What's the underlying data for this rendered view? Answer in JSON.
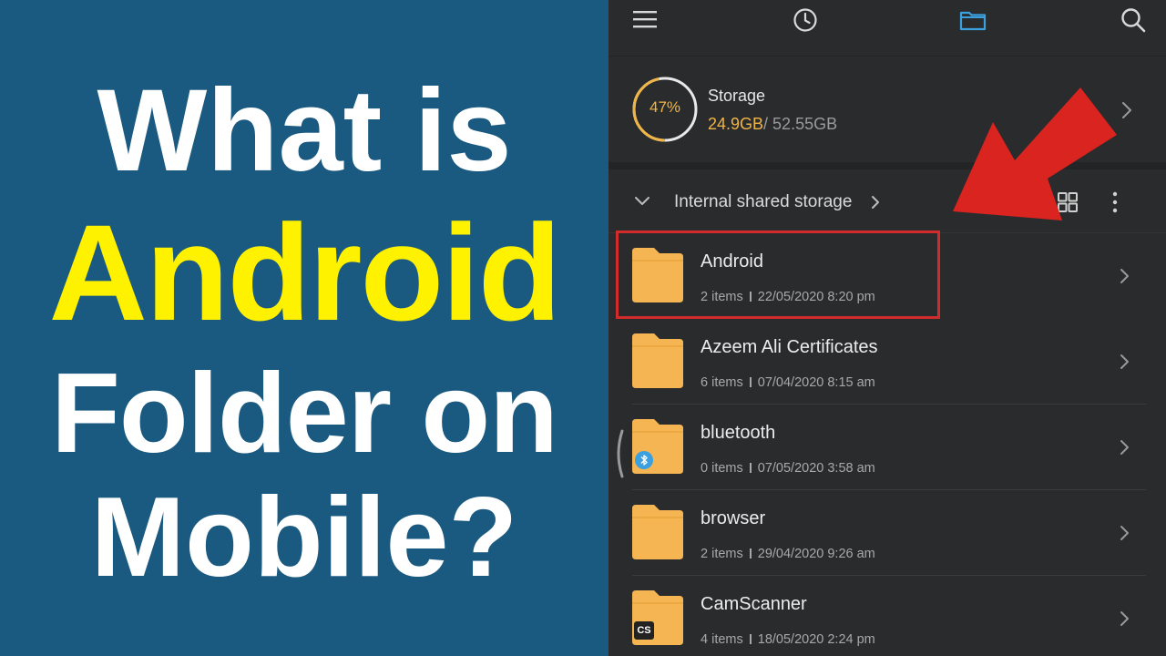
{
  "headline": {
    "line1": "What is",
    "line2": "Android",
    "line3": "Folder on",
    "line4": "Mobile?"
  },
  "toolbar": {
    "icons": [
      "menu-icon",
      "recent-clock-icon",
      "folder-icon",
      "search-icon"
    ]
  },
  "storage": {
    "percent_label": "47%",
    "percent": 47,
    "label": "Storage",
    "used": "24.9GB",
    "total": "/ 52.55GB"
  },
  "breadcrumb": {
    "label": "Internal shared storage"
  },
  "files": [
    {
      "name": "Android",
      "items": "2 items",
      "date": "22/05/2020 8:20 pm"
    },
    {
      "name": "Azeem Ali Certificates",
      "items": "6 items",
      "date": "07/04/2020 8:15 am"
    },
    {
      "name": "bluetooth",
      "items": "0 items",
      "date": "07/05/2020 3:58 am"
    },
    {
      "name": "browser",
      "items": "2 items",
      "date": "29/04/2020 9:26 am"
    },
    {
      "name": "CamScanner",
      "items": "4 items",
      "date": "18/05/2020 2:24 pm",
      "badge": "CS"
    }
  ],
  "colors": {
    "background_left": "#1b5a80",
    "headline_white": "#ffffff",
    "headline_yellow": "#fff200",
    "phone_bg": "#2a2b2d",
    "accent_orange": "#f0b545",
    "folder": "#f4b552",
    "toolbar_active": "#3aa0e0",
    "highlight_red": "#d22b2b"
  }
}
